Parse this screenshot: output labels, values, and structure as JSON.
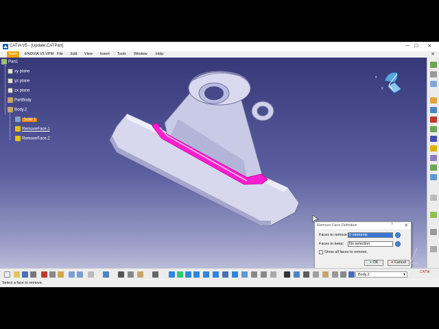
{
  "window": {
    "title": "CATIA V5 - [Update.CATPart]",
    "minimize": "—",
    "maximize": "☐",
    "close": "✕"
  },
  "menu": {
    "items": [
      "Start",
      "ENOVIA V5 VPM",
      "File",
      "Edit",
      "View",
      "Insert",
      "Tools",
      "Window",
      "Help"
    ],
    "doc_close": "✕"
  },
  "tree": {
    "root": "Part1",
    "planes": [
      "xy plane",
      "yz plane",
      "zx plane"
    ],
    "part_body": "PartBody",
    "body2": "Body.2",
    "solid": "Solid.1",
    "remove_face_1": "RemoveFace.1",
    "remove_face_2": "RemoveFace.2"
  },
  "dialog": {
    "title": "Remove Face Definition",
    "help": "?",
    "close": "✕",
    "faces_to_remove_label": "Faces to remove:",
    "faces_to_remove_value": "5 elements",
    "faces_to_keep_label": "Faces to keep:",
    "faces_to_keep_value": "No selection",
    "show_all_label": "Show all faces to remove.",
    "show_all_checked": false,
    "ok_label": "OK",
    "cancel_label": "Cancel"
  },
  "compass": {
    "x": "x",
    "y": "y"
  },
  "bottom_toolbar": {
    "current_body": "Body.2",
    "logo": "CATIA"
  },
  "status": {
    "message": "Select a face to remove."
  },
  "colors": {
    "selection_highlight": "#ff1fd0",
    "active_field": "#3a78d8",
    "tree_selected": "#f08000",
    "background_top": "#363878",
    "background_bottom": "#b8bbd8"
  }
}
